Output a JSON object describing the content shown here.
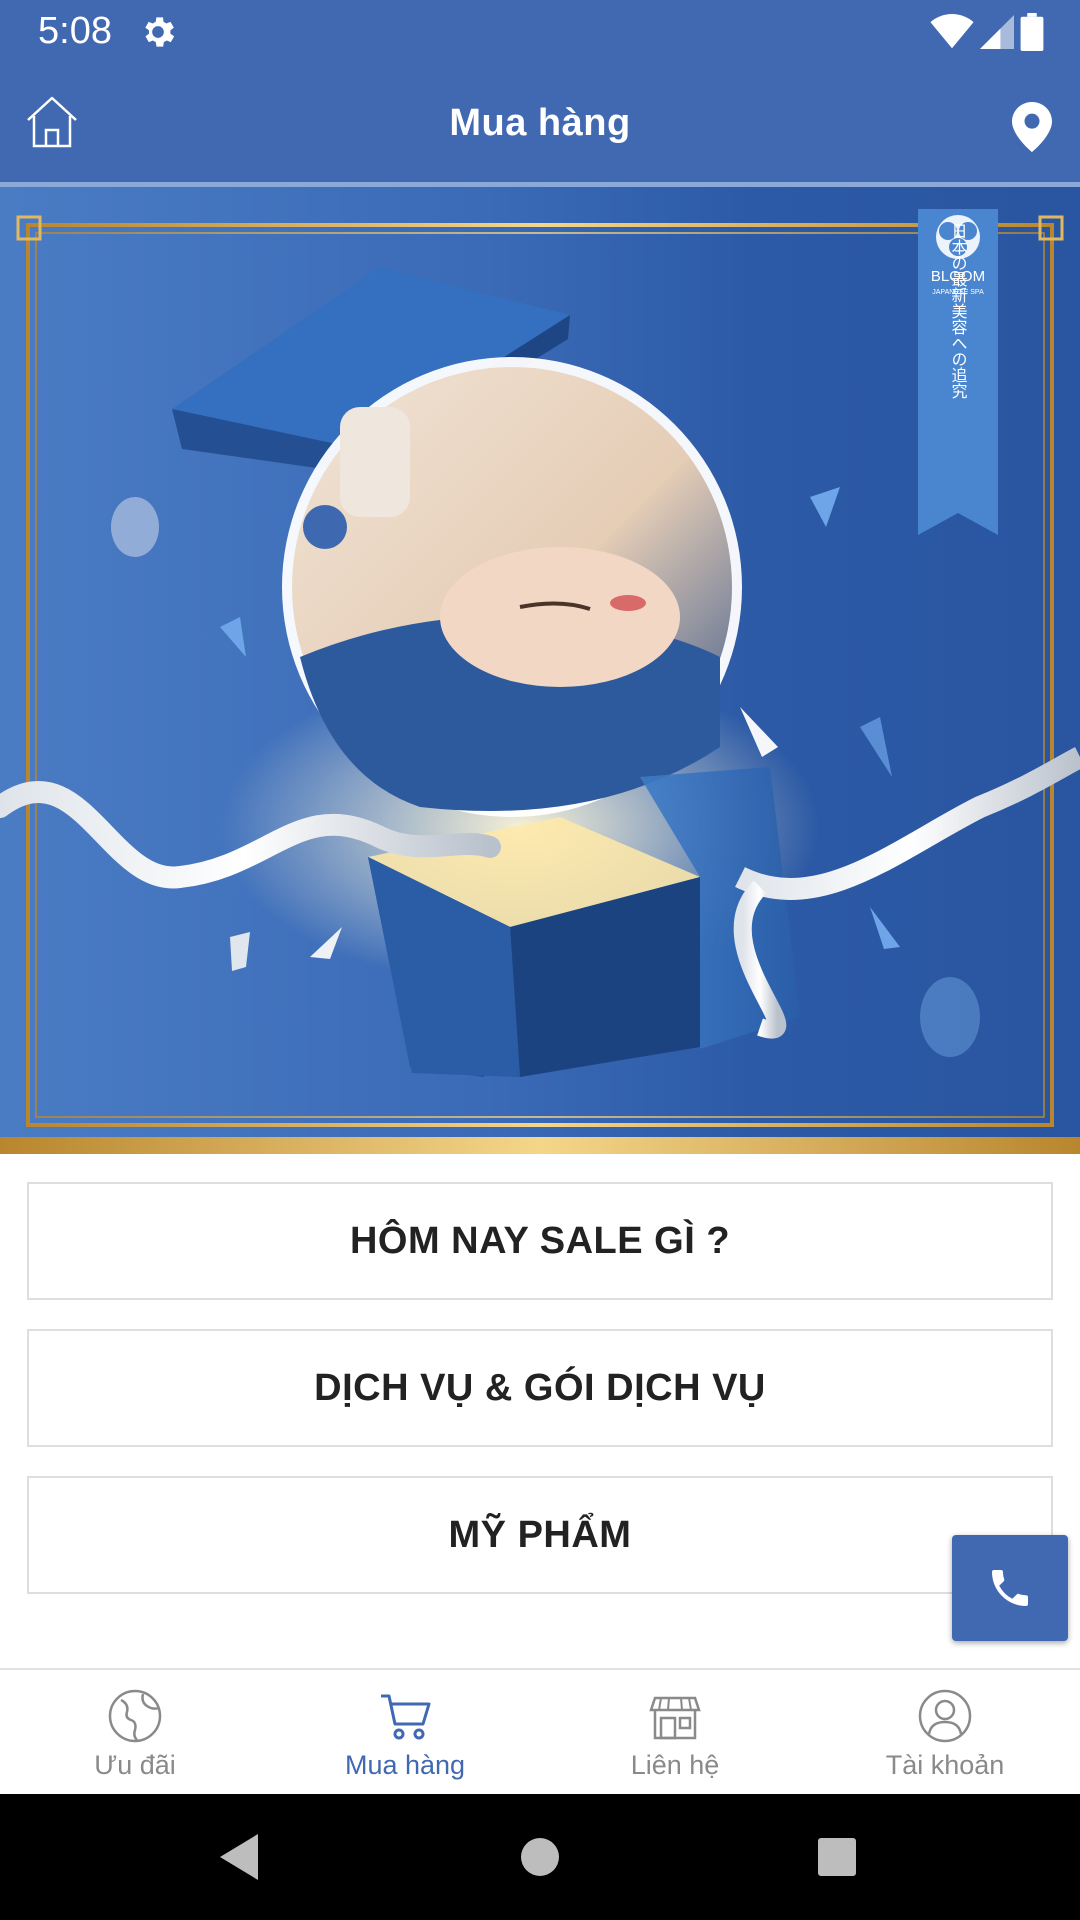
{
  "status_bar": {
    "time": "5:08"
  },
  "app_bar": {
    "title": "Mua hàng"
  },
  "banner": {
    "brand": "BLOOM",
    "tagline": "JAPANESE SPA",
    "vertical_text": "日本の最新美容への追究"
  },
  "menu": [
    {
      "label": "HÔM NAY SALE GÌ ?"
    },
    {
      "label": "DỊCH VỤ & GÓI DỊCH VỤ"
    },
    {
      "label": "MỸ PHẨM"
    }
  ],
  "bottom_nav": [
    {
      "label": "Ưu đãi",
      "icon": "globe-icon",
      "active": false
    },
    {
      "label": "Mua hàng",
      "icon": "cart-icon",
      "active": true
    },
    {
      "label": "Liên hệ",
      "icon": "store-icon",
      "active": false
    },
    {
      "label": "Tài khoản",
      "icon": "account-icon",
      "active": false
    }
  ],
  "colors": {
    "primary": "#4169b2",
    "gold": "#d4a84a"
  }
}
